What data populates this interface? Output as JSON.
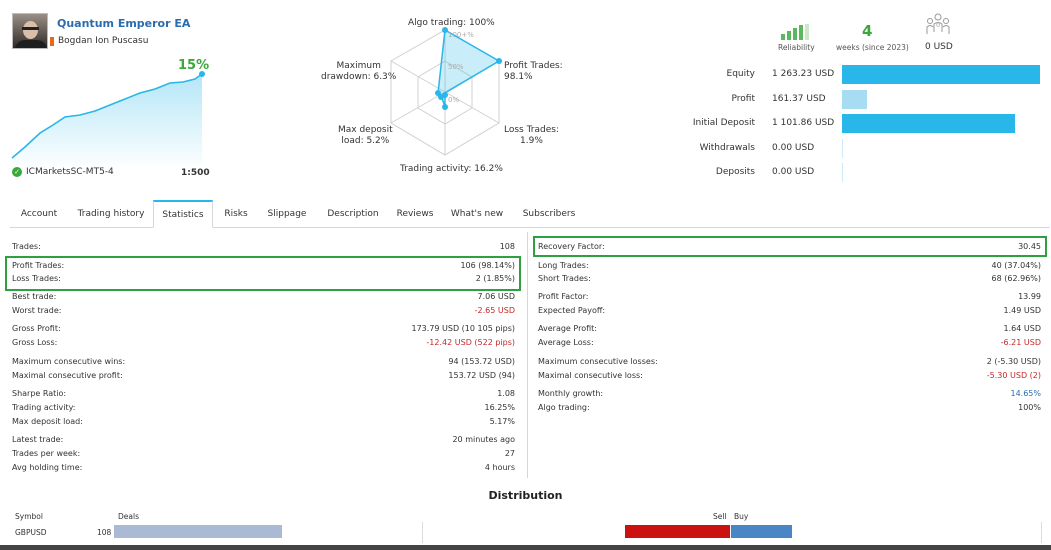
{
  "profile": {
    "ea_name": "Quantum Emperor EA",
    "author": "Bogdan Ion Puscasu",
    "growth": "15%",
    "broker": "ICMarketsSC-MT5-4",
    "leverage": "1:500"
  },
  "radar": {
    "algo_trading": "Algo trading: 100%",
    "profit_trades": "Profit Trades:\n98.1%",
    "loss_trades": "Loss Trades:\n1.9%",
    "trading_activity": "Trading activity: 16.2%",
    "max_deposit_load": "Max deposit\nload: 5.2%",
    "max_drawdown": "Maximum\ndrawdown: 6.3%",
    "ring_100": "100+%",
    "ring_50": "50%",
    "ring_0": "0%"
  },
  "summary": {
    "reliability_label": "Reliability",
    "weeks_value": "4",
    "weeks_label": "weeks (since 2023)",
    "subscribers_value": "0 USD"
  },
  "balance_bars": [
    {
      "label": "Equity",
      "value": "1 263.23 USD",
      "fill": 1.0
    },
    {
      "label": "Profit",
      "value": "161.37 USD",
      "fill": 0.128
    },
    {
      "label": "Initial Deposit",
      "value": "1 101.86 USD",
      "fill": 0.872
    },
    {
      "label": "Withdrawals",
      "value": "0.00 USD",
      "fill": 0
    },
    {
      "label": "Deposits",
      "value": "0.00 USD",
      "fill": 0
    }
  ],
  "tabs": [
    "Account",
    "Trading history",
    "Statistics",
    "Risks",
    "Slippage",
    "Description",
    "Reviews",
    "What's new",
    "Subscribers"
  ],
  "active_tab": "Statistics",
  "stats_left": [
    {
      "k": "Trades:",
      "v": "108"
    },
    {
      "k": "Profit Trades:",
      "v": "106 (98.14%)"
    },
    {
      "k": "Loss Trades:",
      "v": "2 (1.85%)"
    },
    {
      "k": "Best trade:",
      "v": "7.06 USD"
    },
    {
      "k": "Worst trade:",
      "v": "-2.65 USD"
    },
    {
      "k": "Gross Profit:",
      "v": "173.79 USD (10 105 pips)"
    },
    {
      "k": "Gross Loss:",
      "v": "-12.42 USD (522 pips)"
    },
    {
      "k": "Maximum consecutive wins:",
      "v": "94 (153.72 USD)"
    },
    {
      "k": "Maximal consecutive profit:",
      "v": "153.72 USD (94)"
    },
    {
      "k": "Sharpe Ratio:",
      "v": "1.08"
    },
    {
      "k": "Trading activity:",
      "v": "16.25%"
    },
    {
      "k": "Max deposit load:",
      "v": "5.17%"
    },
    {
      "k": "Latest trade:",
      "v": "20 minutes ago"
    },
    {
      "k": "Trades per week:",
      "v": "27"
    },
    {
      "k": "Avg holding time:",
      "v": "4 hours"
    }
  ],
  "stats_right": [
    {
      "k": "Recovery Factor:",
      "v": "30.45"
    },
    {
      "k": "Long Trades:",
      "v": "40 (37.04%)"
    },
    {
      "k": "Short Trades:",
      "v": "68 (62.96%)"
    },
    {
      "k": "Profit Factor:",
      "v": "13.99"
    },
    {
      "k": "Expected Payoff:",
      "v": "1.49 USD"
    },
    {
      "k": "Average Profit:",
      "v": "1.64 USD"
    },
    {
      "k": "Average Loss:",
      "v": "-6.21 USD"
    },
    {
      "k": "Maximum consecutive losses:",
      "v": "2 (-5.30 USD)"
    },
    {
      "k": "Maximal consecutive loss:",
      "v": "-5.30 USD (2)"
    },
    {
      "k": "Monthly growth:",
      "v": "14.65%"
    },
    {
      "k": "Algo trading:",
      "v": "100%"
    }
  ],
  "distribution": {
    "title": "Distribution",
    "col_symbol": "Symbol",
    "col_deals": "Deals",
    "col_sell": "Sell",
    "col_buy": "Buy",
    "rows": [
      {
        "symbol": "GBPUSD",
        "deals": "108",
        "sell_fraction": 0.63,
        "buy_fraction": 0.37
      }
    ]
  },
  "colors": {
    "accent": "#29b6e8",
    "positive": "#3aa83a",
    "negative": "#c62828",
    "sell": "#cc1111",
    "buy": "#4a86c5",
    "highlight": "#2ea043"
  }
}
